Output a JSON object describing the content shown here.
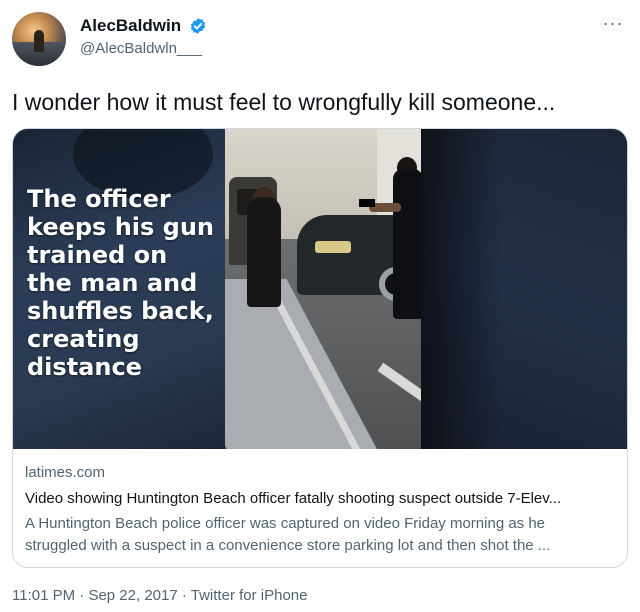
{
  "user": {
    "display_name": "AlecBaldwin",
    "handle": "@AlecBaldwln___",
    "verified": true
  },
  "more_icon": "ellipsis-icon",
  "tweet": {
    "text": "I wonder how it must feel to wrongfully kill someone..."
  },
  "card": {
    "caption_lines": [
      "The officer",
      "keeps his gun",
      "trained on",
      "the man and",
      "shuffles back,",
      "creating",
      "distance"
    ],
    "domain": "latimes.com",
    "title": "Video showing Huntington Beach officer fatally shooting suspect outside 7-Elev...",
    "description_lines": [
      "A Huntington Beach police officer was captured on video Friday morning as he",
      "struggled with a suspect in a convenience store parking lot and then shot the ..."
    ]
  },
  "meta": {
    "time": "11:01 PM",
    "separator": "·",
    "date": "Sep 22, 2017",
    "source": "Twitter for iPhone"
  },
  "colors": {
    "verified": "#1d9bf0",
    "secondary_text": "#536471",
    "primary_text": "#0f1419",
    "border": "#cfd9de"
  }
}
